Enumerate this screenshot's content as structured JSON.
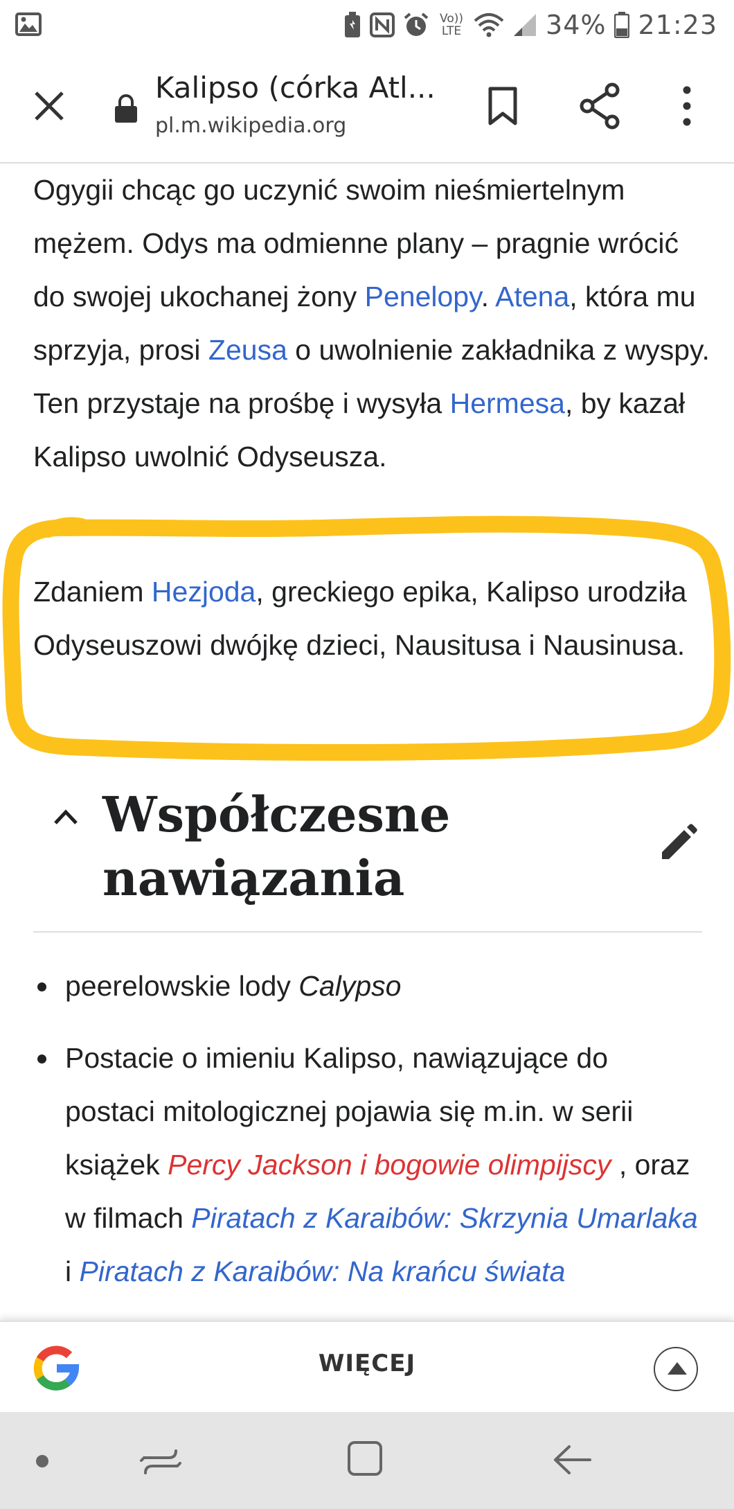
{
  "status_bar": {
    "battery_percent": "34%",
    "time": "21:23",
    "icons": [
      "gallery-icon",
      "battery-saver-icon",
      "nfc-icon",
      "alarm-icon",
      "volte-icon",
      "wifi-icon",
      "signal-icon",
      "battery-icon"
    ],
    "volte_label": "Vo)) LTE"
  },
  "toolbar": {
    "title": "Kalipso (córka Atl...",
    "url": "pl.m.wikipedia.org"
  },
  "article": {
    "paragraph1": {
      "t1": "Ogygii chcąc go uczynić swoim nieśmiertelnym mężem. Odys ma odmienne plany – pragnie wrócić do swojej ukochanej żony ",
      "link_penelopy": "Penelopy",
      "t2": ". ",
      "link_atena": "Atena",
      "t3": ", która mu sprzyja, prosi ",
      "link_zeusa": "Zeusa",
      "t4": " o uwolnienie zakładnika z wyspy. Ten przystaje na prośbę i wysyła ",
      "link_hermesa": "Hermesa",
      "t5": ", by kazał Kalipso uwolnić Odyseusza."
    },
    "paragraph2": {
      "t1": "Zdaniem ",
      "link_hezjoda": "Hezjoda",
      "t2": ", greckiego epika, Kalipso urodziła Odyseuszowi dwójkę dzieci, Nausitusa i Nausinusa."
    },
    "highlight_color": "#fcc21b",
    "section": {
      "title": "Współczesne nawiązania"
    },
    "list": {
      "item1": {
        "t1": "peerelowskie lody ",
        "italic": "Calypso"
      },
      "item2": {
        "t1": "Postacie o imieniu Kalipso, nawiązujące do postaci mitologicznej pojawia się m.in. w serii książek ",
        "link_percy": "Percy Jackson i bogowie olimpijscy",
        "t2": " , oraz w filmach ",
        "link_piraci1": "Piratach z Karaibów: Skrzynia Umarlaka",
        "t3": " i ",
        "link_piraci2": "Piratach z Karaibów: Na krańcu świata"
      }
    },
    "link_color": "#3366cc",
    "redlink_color": "#dd3333"
  },
  "bottom_bar": {
    "more_label": "WIĘCEJ"
  }
}
